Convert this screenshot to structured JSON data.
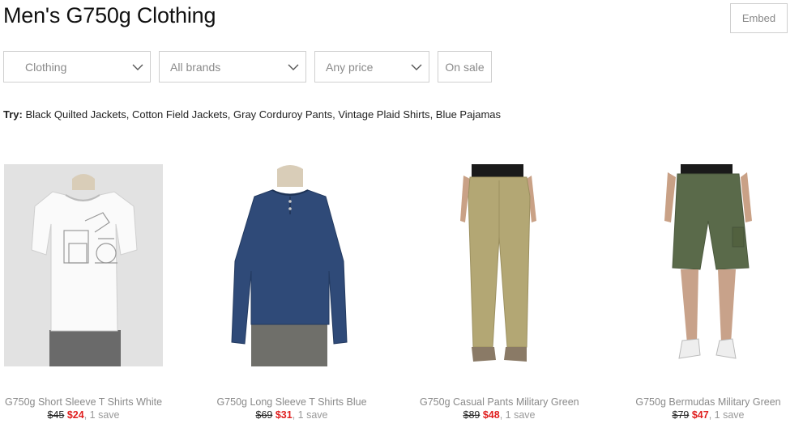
{
  "page": {
    "title": "Men's G750g Clothing",
    "embed_label": "Embed"
  },
  "filters": {
    "category": "Clothing",
    "brand": "All brands",
    "price": "Any price",
    "on_sale": "On sale"
  },
  "try": {
    "label": "Try:",
    "links": [
      "Black Quilted Jackets",
      "Cotton Field Jackets",
      "Gray Corduroy Pants",
      "Vintage Plaid Shirts",
      "Blue Pajamas"
    ]
  },
  "products": [
    {
      "name": "G750g Short Sleeve T Shirts White",
      "old_price": "$45",
      "new_price": "$24",
      "saves": "1 save"
    },
    {
      "name": "G750g Long Sleeve T Shirts Blue",
      "old_price": "$69",
      "new_price": "$31",
      "saves": "1 save"
    },
    {
      "name": "G750g Casual Pants Military Green",
      "old_price": "$89",
      "new_price": "$48",
      "saves": "1 save"
    },
    {
      "name": "G750g Bermudas Military Green",
      "old_price": "$79",
      "new_price": "$47",
      "saves": "1 save"
    }
  ]
}
